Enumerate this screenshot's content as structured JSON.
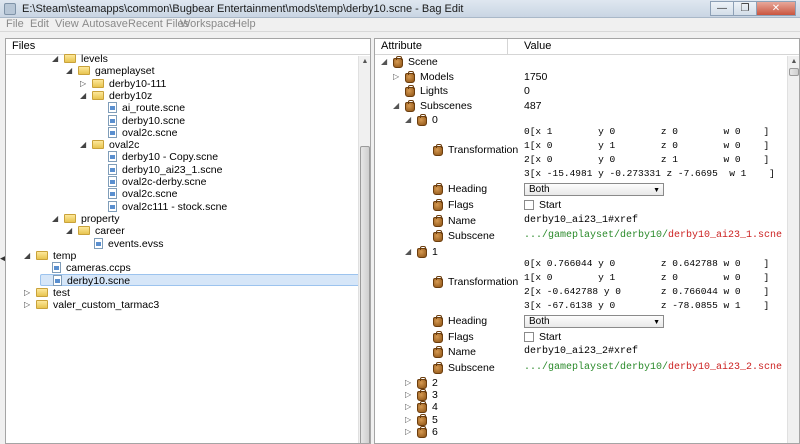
{
  "window": {
    "title": "E:\\Steam\\steamapps\\common\\Bugbear Entertainment\\mods\\temp\\derby10.scne - Bag Edit",
    "minimize": "—",
    "maximize": "❐",
    "close": "✕"
  },
  "menu": [
    "File",
    "Edit",
    "View",
    "Autosave",
    "Recent Files",
    "Workspace",
    "Help"
  ],
  "files_panel": {
    "header": "Files",
    "tree": [
      {
        "label": "levels",
        "type": "folder",
        "depth": 3,
        "expanded": true
      },
      {
        "label": "gameplayset",
        "type": "folder",
        "depth": 4,
        "expanded": true
      },
      {
        "label": "derby10-111",
        "type": "folder",
        "depth": 5,
        "expanded": false
      },
      {
        "label": "derby10z",
        "type": "folder",
        "depth": 5,
        "expanded": true
      },
      {
        "label": "ai_route.scne",
        "type": "file",
        "depth": 6
      },
      {
        "label": "derby10.scne",
        "type": "file",
        "depth": 6
      },
      {
        "label": "oval2c.scne",
        "type": "file",
        "depth": 6
      },
      {
        "label": "oval2c",
        "type": "folder",
        "depth": 5,
        "expanded": true
      },
      {
        "label": "derby10 - Copy.scne",
        "type": "file",
        "depth": 6
      },
      {
        "label": "derby10_ai23_1.scne",
        "type": "file",
        "depth": 6
      },
      {
        "label": "oval2c-derby.scne",
        "type": "file",
        "depth": 6
      },
      {
        "label": "oval2c.scne",
        "type": "file",
        "depth": 6
      },
      {
        "label": "oval2c111 - stock.scne",
        "type": "file",
        "depth": 6
      },
      {
        "label": "property",
        "type": "folder",
        "depth": 3,
        "expanded": true
      },
      {
        "label": "career",
        "type": "folder",
        "depth": 4,
        "expanded": true
      },
      {
        "label": "events.evss",
        "type": "file",
        "depth": 5
      },
      {
        "label": "temp",
        "type": "folder",
        "depth": 1,
        "expanded": true
      },
      {
        "label": "cameras.ccps",
        "type": "file",
        "depth": 2
      },
      {
        "label": "derby10.scne",
        "type": "file",
        "depth": 2,
        "selected": true
      },
      {
        "label": "test",
        "type": "folder",
        "depth": 1,
        "expanded": false
      },
      {
        "label": "valer_custom_tarmac3",
        "type": "folder",
        "depth": 1,
        "expanded": false
      }
    ]
  },
  "attributes_panel": {
    "col_attribute": "Attribute",
    "col_value": "Value",
    "scene": {
      "label": "Scene",
      "models_label": "Models",
      "models_value": "1750",
      "lights_label": "Lights",
      "lights_value": "0",
      "subscenes_label": "Subscenes",
      "subscenes_value": "487",
      "items": [
        {
          "index": "0",
          "transformation_label": "Transformation",
          "matrix": [
            "0[x 1        y 0        z 0        w 0    ]",
            "1[x 0        y 1        z 0        w 0    ]",
            "2[x 0        y 0        z 1        w 0    ]",
            "3[x -15.4981 y -0.273331 z -7.6695  w 1    ]"
          ],
          "heading_label": "Heading",
          "heading_value": "Both",
          "flags_label": "Flags",
          "flags_value": "Start",
          "name_label": "Name",
          "name_value": "derby10_ai23_1#xref",
          "subscene_label": "Subscene",
          "subscene_path": ".../gameplayset/derby10/",
          "subscene_file": "derby10_ai23_1.scne"
        },
        {
          "index": "1",
          "transformation_label": "Transformation",
          "matrix": [
            "0[x 0.766044 y 0        z 0.642788 w 0    ]",
            "1[x 0        y 1        z 0        w 0    ]",
            "2[x -0.642788 y 0       z 0.766044 w 0    ]",
            "3[x -67.6138 y 0        z -78.0855 w 1    ]"
          ],
          "heading_label": "Heading",
          "heading_value": "Both",
          "flags_label": "Flags",
          "flags_value": "Start",
          "name_label": "Name",
          "name_value": "derby10_ai23_2#xref",
          "subscene_label": "Subscene",
          "subscene_path": ".../gameplayset/derby10/",
          "subscene_file": "derby10_ai23_2.scne"
        }
      ],
      "collapsed_items": [
        "2",
        "3",
        "4",
        "5",
        "6"
      ]
    }
  }
}
